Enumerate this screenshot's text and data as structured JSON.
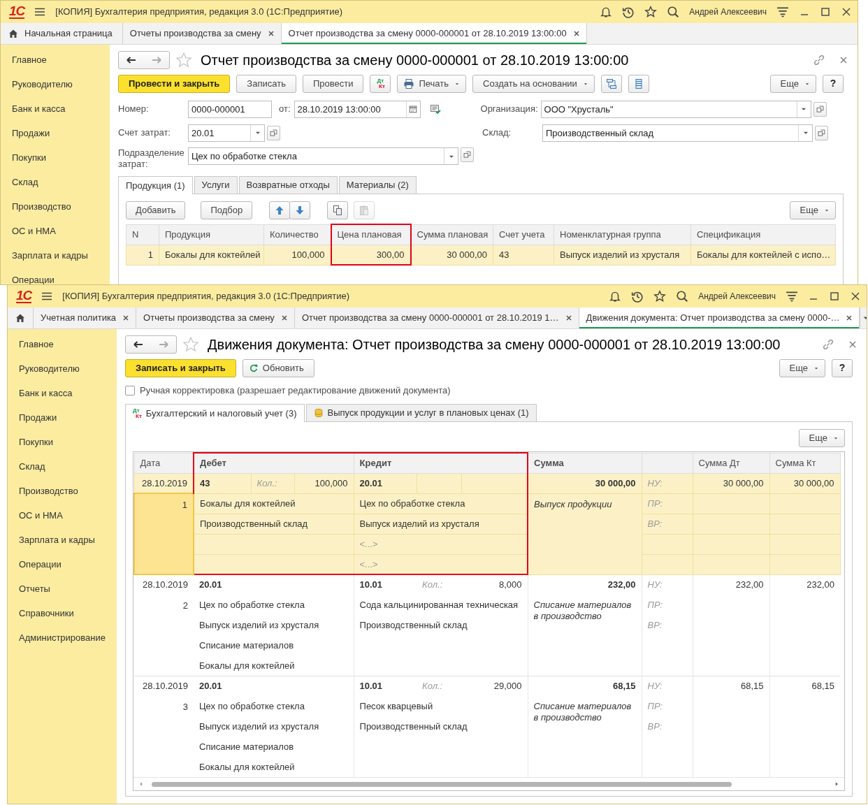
{
  "back_window": {
    "logo": "1С",
    "title": "[КОПИЯ] Бухгалтерия предприятия, редакция 3.0  (1С:Предприятие)",
    "user": "Андрей Алексеевич",
    "tabs": [
      {
        "kind": "home",
        "label": "Начальная страница",
        "closable": false,
        "selected": false
      },
      {
        "kind": "page",
        "label": "Отчеты производства за смену",
        "closable": true,
        "selected": false
      },
      {
        "kind": "page",
        "label": "Отчет производства за смену 0000-000001 от 28.10.2019 13:00:00",
        "closable": true,
        "selected": true
      }
    ],
    "sidebar": [
      "Главное",
      "Руководителю",
      "Банк и касса",
      "Продажи",
      "Покупки",
      "Склад",
      "Производство",
      "ОС и НМА",
      "Зарплата и кадры",
      "Операции"
    ],
    "form_title": "Отчет производства за смену 0000-000001 от 28.10.2019 13:00:00",
    "toolbar": [
      {
        "kind": "primary",
        "label": "Провести и закрыть"
      },
      {
        "kind": "plain",
        "label": "Записать"
      },
      {
        "kind": "plain",
        "label": "Провести"
      },
      {
        "kind": "postings",
        "top": "Дт",
        "bottom": "Кт"
      },
      {
        "kind": "print",
        "label": "Печать"
      },
      {
        "kind": "menu",
        "label": "Создать на основании"
      },
      {
        "kind": "structure"
      },
      {
        "kind": "list"
      }
    ],
    "toolbar_right": [
      {
        "kind": "menu",
        "label": "Еще"
      },
      {
        "kind": "help",
        "label": "?"
      }
    ],
    "fields": {
      "number": {
        "label": "Номер:",
        "value": "0000-000001"
      },
      "date": {
        "label": "от:",
        "value": "28.10.2019 13:00:00"
      },
      "organization": {
        "label": "Организация:",
        "value": "ООО \"Хрусталь\""
      },
      "cost_account": {
        "label": "Счет затрат:",
        "value": "20.01"
      },
      "warehouse": {
        "label": "Склад:",
        "value": "Производственный склад"
      },
      "department": {
        "label": "Подразделение затрат:",
        "value": "Цех по обработке стекла"
      }
    },
    "form_tabs": [
      {
        "label": "Продукция (1)",
        "selected": true
      },
      {
        "label": "Услуги",
        "selected": false
      },
      {
        "label": "Возвратные отходы",
        "selected": false
      },
      {
        "label": "Материалы (2)",
        "selected": false
      }
    ],
    "table_toolbar": [
      {
        "kind": "plain",
        "label": "Добавить",
        "disabled": false
      },
      {
        "kind": "plain",
        "label": "Подбор",
        "disabled": false
      },
      {
        "kind": "up",
        "disabled": false
      },
      {
        "kind": "down",
        "disabled": false
      },
      {
        "kind": "copy",
        "disabled": false
      },
      {
        "kind": "paste",
        "disabled": true
      }
    ],
    "table_toolbar_right": [
      {
        "kind": "menu",
        "label": "Еще"
      }
    ],
    "table": {
      "columns": [
        {
          "label": "N",
          "kind": "number",
          "highlighted": false
        },
        {
          "label": "Продукция",
          "kind": "text",
          "highlighted": false
        },
        {
          "label": "Количество",
          "kind": "number",
          "highlighted": false
        },
        {
          "label": "Цена плановая",
          "kind": "number",
          "highlighted": true
        },
        {
          "label": "Сумма плановая",
          "kind": "number",
          "highlighted": false
        },
        {
          "label": "Счет учета",
          "kind": "text",
          "highlighted": false
        },
        {
          "label": "Номенклатурная группа",
          "kind": "text",
          "highlighted": false
        },
        {
          "label": "Спецификация",
          "kind": "text",
          "highlighted": false
        }
      ],
      "rows": [
        {
          "selected": true,
          "highlighted": true,
          "cells": [
            "1",
            "Бокалы для коктейлей",
            "100,000",
            "300,00",
            "30 000,00",
            "43",
            "Выпуск изделий из хрусталя",
            "Бокалы для коктейлей с испо…"
          ]
        }
      ]
    }
  },
  "front_window": {
    "logo": "1С",
    "title": "[КОПИЯ] Бухгалтерия предприятия, редакция 3.0  (1С:Предприятие)",
    "user": "Андрей Алексеевич",
    "tabs": [
      {
        "kind": "home",
        "closable": false,
        "selected": false
      },
      {
        "kind": "page",
        "label": "Учетная политика",
        "closable": true,
        "selected": false
      },
      {
        "kind": "page",
        "label": "Отчеты производства за смену",
        "closable": true,
        "selected": false
      },
      {
        "kind": "page",
        "label": "Отчет производства за смену 0000-000001 от 28.10.2019 1…",
        "closable": true,
        "selected": false
      },
      {
        "kind": "page",
        "label": "Движения документа: Отчет производства за смену 0000-…",
        "closable": true,
        "selected": true
      }
    ],
    "sidebar": [
      "Главное",
      "Руководителю",
      "Банк и касса",
      "Продажи",
      "Покупки",
      "Склад",
      "Производство",
      "ОС и НМА",
      "Зарплата и кадры",
      "Операции",
      "Отчеты",
      "Справочники",
      "Администрирование"
    ],
    "form_title": "Движения документа: Отчет производства за смену 0000-000001 от 28.10.2019 13:00:00",
    "toolbar": [
      {
        "kind": "primary",
        "label": "Записать и закрыть"
      },
      {
        "kind": "refresh",
        "label": "Обновить"
      }
    ],
    "toolbar_right": [
      {
        "kind": "menu",
        "label": "Еще"
      },
      {
        "kind": "help",
        "label": "?"
      }
    ],
    "manual_edit": {
      "label": "Ручная корректировка (разрешает редактирование движений документа)",
      "checked": false
    },
    "form_tabs": [
      {
        "kind": "postings",
        "top": "Дт",
        "bottom": "Кт",
        "label": "Бухгалтерский и налоговый учет (3)",
        "selected": true
      },
      {
        "kind": "register",
        "label": "Выпуск продукции и услуг в плановых ценах (1)",
        "selected": false
      }
    ],
    "table_toolbar_right": [
      {
        "kind": "menu",
        "label": "Еще"
      }
    ],
    "table": {
      "columns": [
        {
          "label": "Дата",
          "kind": "plain",
          "highlighted": false
        },
        {
          "label": "Дебет",
          "kind": "group",
          "highlighted": true
        },
        {
          "label": "Кредит",
          "kind": "group",
          "highlighted": true
        },
        {
          "label": "Сумма",
          "kind": "group",
          "highlighted": false
        },
        {
          "kind": "blank",
          "highlighted": false
        },
        {
          "label": "Сумма Дт",
          "kind": "plain",
          "highlighted": false
        },
        {
          "label": "Сумма Кт",
          "kind": "plain",
          "highlighted": false
        }
      ],
      "entries": [
        {
          "date": "28.10.2019",
          "number": "1",
          "selected": true,
          "highlighted": true,
          "debit": {
            "account": "43",
            "qty_label": "Кол.:",
            "qty": "100,000",
            "lines": [
              {
                "text": "Бокалы для коктейлей",
                "empty": false
              },
              {
                "text": "Производственный склад",
                "empty": false
              }
            ]
          },
          "credit": {
            "account": "20.01",
            "lines": [
              {
                "text": "Цех по обработке стекла",
                "empty": false
              },
              {
                "text": "Выпуск изделий из хрусталя",
                "empty": false
              },
              {
                "text": "<...>",
                "empty": true
              },
              {
                "text": "<...>",
                "empty": true
              }
            ]
          },
          "sum": "30 000,00",
          "content": "Выпуск продукции",
          "tax_labels": [
            "НУ:",
            "ПР:",
            "ВР:"
          ],
          "sum_dt": "30 000,00",
          "sum_kt": "30 000,00"
        },
        {
          "date": "28.10.2019",
          "number": "2",
          "selected": false,
          "highlighted": false,
          "debit": {
            "account": "20.01",
            "lines": [
              {
                "text": "Цех по обработке стекла",
                "empty": false
              },
              {
                "text": "Выпуск изделий из хрусталя",
                "empty": false
              },
              {
                "text": "Списание материалов",
                "empty": false
              },
              {
                "text": "Бокалы для коктейлей",
                "empty": false
              }
            ]
          },
          "credit": {
            "account": "10.01",
            "qty_label": "Кол.:",
            "qty": "8,000",
            "lines": [
              {
                "text": "Сода кальцинированная техническая",
                "empty": false
              },
              {
                "text": "Производственный склад",
                "empty": false
              }
            ]
          },
          "sum": "232,00",
          "content": "Списание материалов в производство",
          "tax_labels": [
            "НУ:",
            "ПР:",
            "ВР:"
          ],
          "sum_dt": "232,00",
          "sum_kt": "232,00"
        },
        {
          "date": "28.10.2019",
          "number": "3",
          "selected": false,
          "highlighted": false,
          "debit": {
            "account": "20.01",
            "lines": [
              {
                "text": "Цех по обработке стекла",
                "empty": false
              },
              {
                "text": "Выпуск изделий из хрусталя",
                "empty": false
              },
              {
                "text": "Списание материалов",
                "empty": false
              },
              {
                "text": "Бокалы для коктейлей",
                "empty": false
              }
            ]
          },
          "credit": {
            "account": "10.01",
            "qty_label": "Кол.:",
            "qty": "29,000",
            "lines": [
              {
                "text": "Песок кварцевый",
                "empty": false
              },
              {
                "text": "Производственный склад",
                "empty": false
              }
            ]
          },
          "sum": "68,15",
          "content": "Списание материалов в производство",
          "tax_labels": [
            "НУ:",
            "ПР:",
            "ВР:"
          ],
          "sum_dt": "68,15",
          "sum_kt": "68,15"
        }
      ]
    }
  }
}
